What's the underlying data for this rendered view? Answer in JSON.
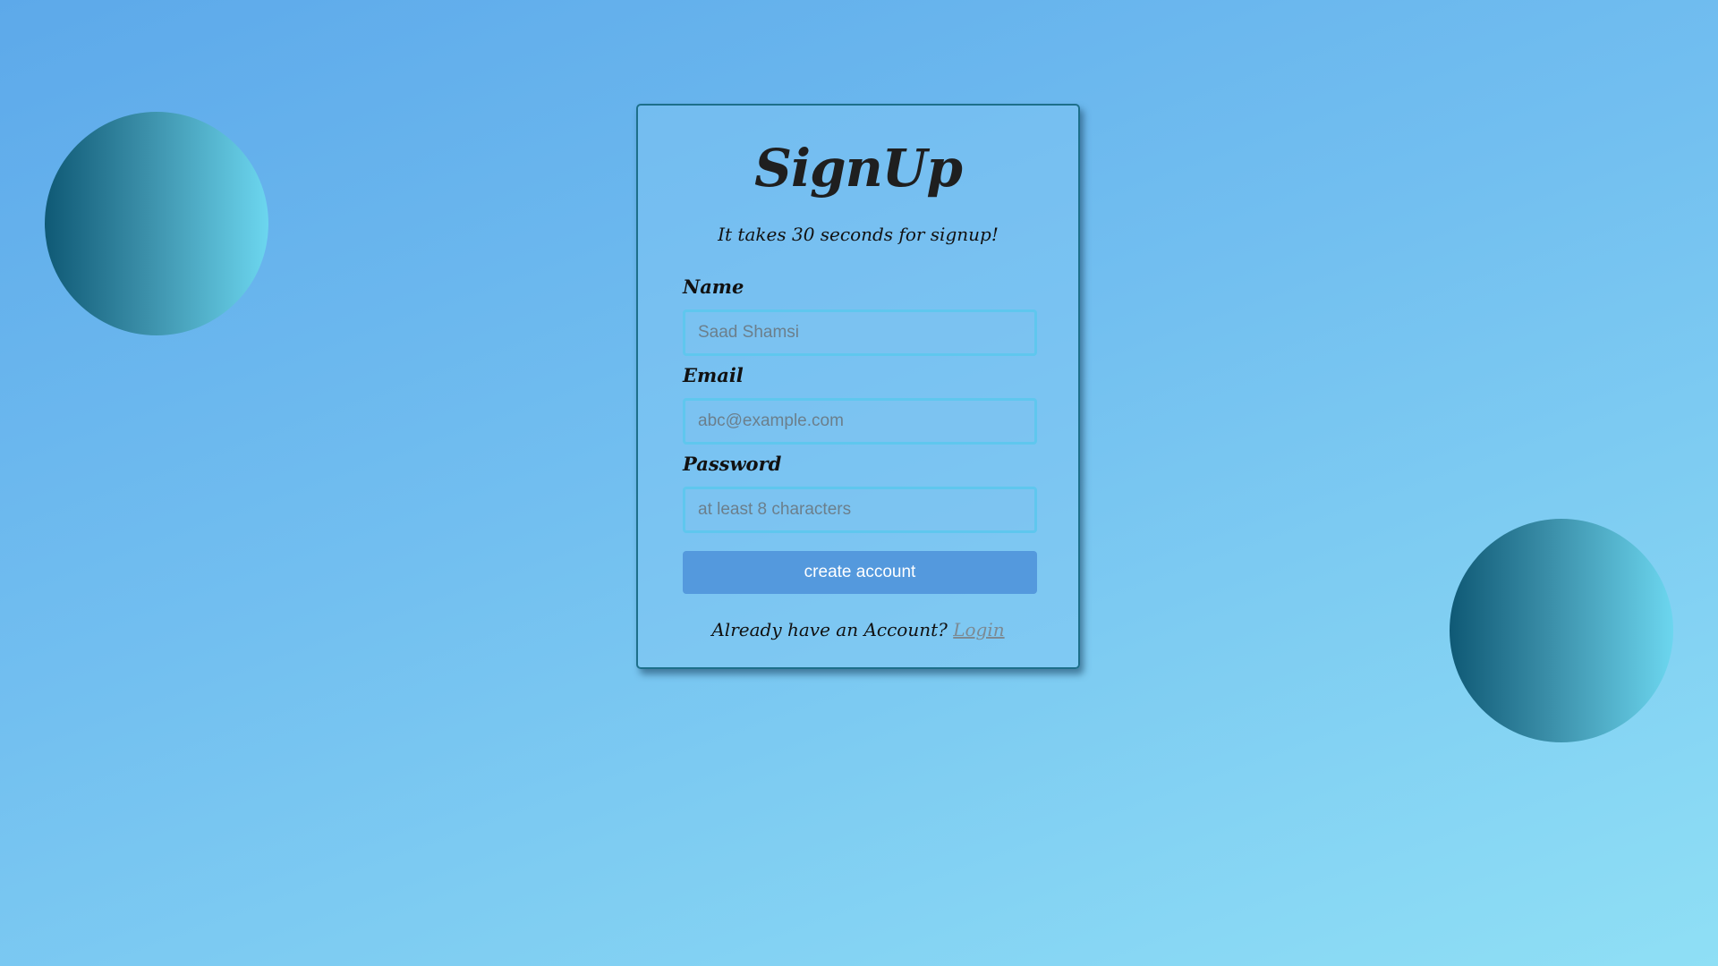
{
  "form": {
    "title": "SignUp",
    "subtitle": "It takes 30 seconds for signup!",
    "fields": {
      "name": {
        "label": "Name",
        "placeholder": "Saad Shamsi"
      },
      "email": {
        "label": "Email",
        "placeholder": "abc@example.com"
      },
      "password": {
        "label": "Password",
        "placeholder": "at least 8 characters"
      }
    },
    "submit_label": "create account",
    "footer": {
      "prompt": "Already have an Account?",
      "link_label": "Login"
    }
  },
  "colors": {
    "background_start": "#5da9ea",
    "background_end": "#8fdff5",
    "circle_dark": "#0f5975",
    "circle_light": "#6cd6ef",
    "button": "#5499dd",
    "input_border": "#5fc7ee",
    "card_border": "#1d6f8a",
    "link": "#7c8a93"
  }
}
